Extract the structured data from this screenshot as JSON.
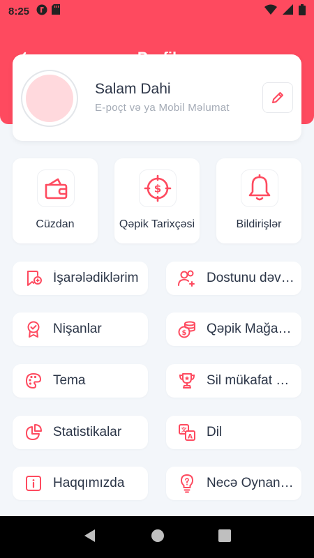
{
  "status_bar": {
    "time": "8:25"
  },
  "header": {
    "title": "Profil"
  },
  "profile": {
    "name": "Salam Dahi",
    "subtitle": "E-poçt və ya Mobil Məlumat"
  },
  "tiles": [
    {
      "label": "Cüzdan",
      "icon": "wallet-icon"
    },
    {
      "label": "Qəpik Tarixçəsi",
      "icon": "coin-history-icon"
    },
    {
      "label": "Bildirişlər",
      "icon": "bell-icon"
    }
  ],
  "menu": [
    {
      "label": "İşarələdiklərim",
      "icon": "bookmark-add-icon"
    },
    {
      "label": "Dostunu dəvət et",
      "icon": "invite-friend-icon"
    },
    {
      "label": "Nişanlar",
      "icon": "badge-icon"
    },
    {
      "label": "Qəpik Mağazası",
      "icon": "coin-store-icon"
    },
    {
      "label": "Tema",
      "icon": "palette-icon"
    },
    {
      "label": "Sil mükafat balları",
      "icon": "trophy-icon"
    },
    {
      "label": "Statistikalar",
      "icon": "pie-chart-icon"
    },
    {
      "label": "Dil",
      "icon": "translate-icon"
    },
    {
      "label": "Haqqımızda",
      "icon": "info-icon"
    },
    {
      "label": "Necə Oynanılır",
      "icon": "lightbulb-icon"
    }
  ],
  "colors": {
    "accent": "#fe4a5f",
    "background": "#f3f6fa",
    "card": "#ffffff",
    "text": "#2b3547",
    "muted": "#a3aab5"
  }
}
